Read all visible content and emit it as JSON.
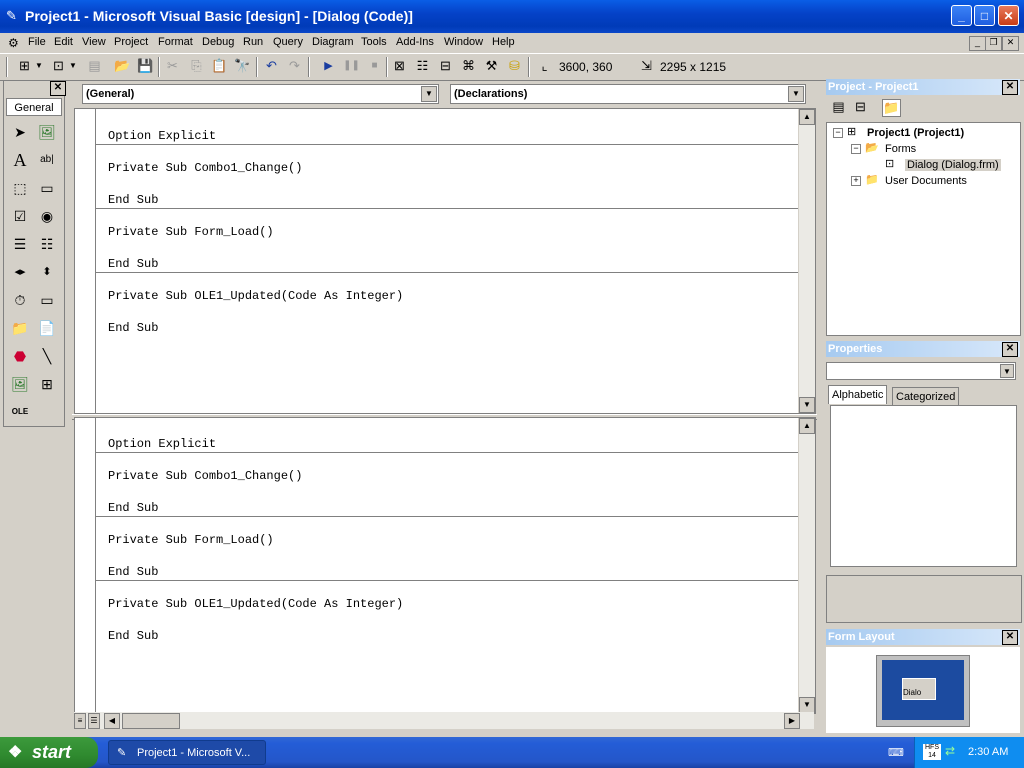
{
  "window": {
    "title": "Project1 - Microsoft Visual Basic [design] - [Dialog (Code)]",
    "minimize": "_",
    "maximize": "□",
    "close": "✕"
  },
  "menu": [
    "File",
    "Edit",
    "View",
    "Project",
    "Format",
    "Debug",
    "Run",
    "Query",
    "Diagram",
    "Tools",
    "Add-Ins",
    "Window",
    "Help"
  ],
  "toolbar": {
    "position": "3600, 360",
    "size": "2295 x 1215"
  },
  "toolbox": {
    "tab_label": "General",
    "close": "✕"
  },
  "code": {
    "object_combo": "(General)",
    "proc_combo": "(Declarations)",
    "lines": [
      "Option Explicit",
      "Private Sub Combo1_Change()",
      "End Sub",
      "Private Sub Form_Load()",
      "End Sub",
      "Private Sub OLE1_Updated(Code As Integer)",
      "End Sub"
    ]
  },
  "project_panel": {
    "title": "Project - Project1",
    "tree": {
      "root": "Project1 (Project1)",
      "forms": "Forms",
      "dialog": "Dialog (Dialog.frm)",
      "user_docs": "User Documents"
    }
  },
  "properties_panel": {
    "title": "Properties",
    "tab_alphabetic": "Alphabetic",
    "tab_categorized": "Categorized"
  },
  "form_layout_panel": {
    "title": "Form Layout",
    "preview_label": "Dialo"
  },
  "taskbar": {
    "start": "start",
    "task": "Project1 - Microsoft V...",
    "clock": "2:30 AM"
  }
}
